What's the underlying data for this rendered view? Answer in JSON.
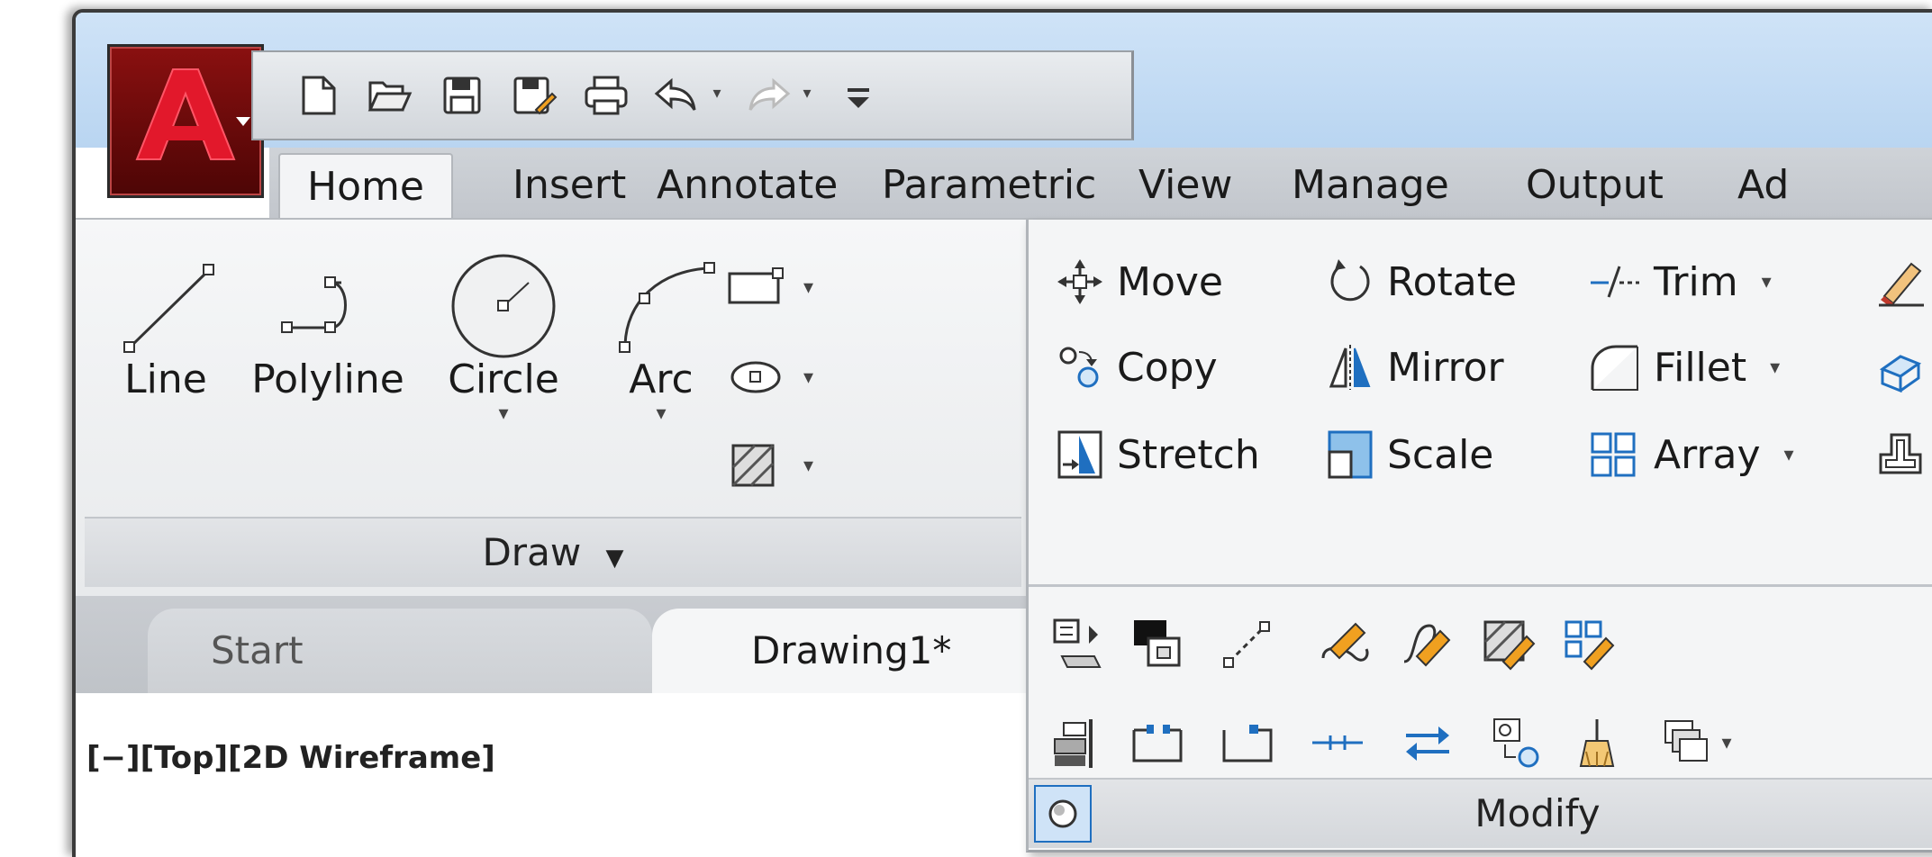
{
  "app": {
    "logo_letter": "A"
  },
  "quick_access": {
    "items": [
      {
        "icon": "new-file-icon"
      },
      {
        "icon": "open-folder-icon"
      },
      {
        "icon": "save-icon"
      },
      {
        "icon": "save-as-icon"
      },
      {
        "icon": "print-icon"
      },
      {
        "icon": "undo-icon"
      },
      {
        "icon": "redo-icon"
      },
      {
        "icon": "customize-icon"
      }
    ]
  },
  "ribbon_tabs": [
    "Home",
    "Insert",
    "Annotate",
    "Parametric",
    "View",
    "Manage",
    "Output",
    "Ad"
  ],
  "draw_panel": {
    "title": "Draw",
    "buttons": [
      {
        "label": "Line"
      },
      {
        "label": "Polyline"
      },
      {
        "label": "Circle"
      },
      {
        "label": "Arc"
      }
    ]
  },
  "modify_panel": {
    "title": "Modify",
    "rows": [
      [
        "Move",
        "Rotate",
        "Trim"
      ],
      [
        "Copy",
        "Mirror",
        "Fillet"
      ],
      [
        "Stretch",
        "Scale",
        "Array"
      ]
    ]
  },
  "doc_tabs": {
    "start": "Start",
    "drawing": "Drawing1*"
  },
  "viewport": {
    "label": "[−][Top][2D Wireframe]"
  },
  "colors": {
    "accent_blue": "#1f6fc0",
    "app_red": "#c8102e",
    "ribbon_bg": "#eceef0"
  }
}
